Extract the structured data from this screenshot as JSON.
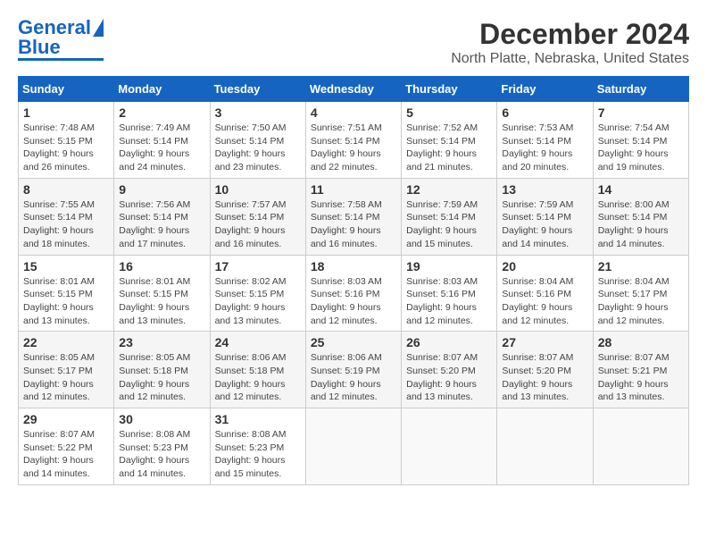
{
  "logo": {
    "line1": "General",
    "line2": "Blue"
  },
  "title": "December 2024",
  "subtitle": "North Platte, Nebraska, United States",
  "days_of_week": [
    "Sunday",
    "Monday",
    "Tuesday",
    "Wednesday",
    "Thursday",
    "Friday",
    "Saturday"
  ],
  "weeks": [
    [
      {
        "num": "1",
        "sunrise": "Sunrise: 7:48 AM",
        "sunset": "Sunset: 5:15 PM",
        "daylight": "Daylight: 9 hours and 26 minutes."
      },
      {
        "num": "2",
        "sunrise": "Sunrise: 7:49 AM",
        "sunset": "Sunset: 5:14 PM",
        "daylight": "Daylight: 9 hours and 24 minutes."
      },
      {
        "num": "3",
        "sunrise": "Sunrise: 7:50 AM",
        "sunset": "Sunset: 5:14 PM",
        "daylight": "Daylight: 9 hours and 23 minutes."
      },
      {
        "num": "4",
        "sunrise": "Sunrise: 7:51 AM",
        "sunset": "Sunset: 5:14 PM",
        "daylight": "Daylight: 9 hours and 22 minutes."
      },
      {
        "num": "5",
        "sunrise": "Sunrise: 7:52 AM",
        "sunset": "Sunset: 5:14 PM",
        "daylight": "Daylight: 9 hours and 21 minutes."
      },
      {
        "num": "6",
        "sunrise": "Sunrise: 7:53 AM",
        "sunset": "Sunset: 5:14 PM",
        "daylight": "Daylight: 9 hours and 20 minutes."
      },
      {
        "num": "7",
        "sunrise": "Sunrise: 7:54 AM",
        "sunset": "Sunset: 5:14 PM",
        "daylight": "Daylight: 9 hours and 19 minutes."
      }
    ],
    [
      {
        "num": "8",
        "sunrise": "Sunrise: 7:55 AM",
        "sunset": "Sunset: 5:14 PM",
        "daylight": "Daylight: 9 hours and 18 minutes."
      },
      {
        "num": "9",
        "sunrise": "Sunrise: 7:56 AM",
        "sunset": "Sunset: 5:14 PM",
        "daylight": "Daylight: 9 hours and 17 minutes."
      },
      {
        "num": "10",
        "sunrise": "Sunrise: 7:57 AM",
        "sunset": "Sunset: 5:14 PM",
        "daylight": "Daylight: 9 hours and 16 minutes."
      },
      {
        "num": "11",
        "sunrise": "Sunrise: 7:58 AM",
        "sunset": "Sunset: 5:14 PM",
        "daylight": "Daylight: 9 hours and 16 minutes."
      },
      {
        "num": "12",
        "sunrise": "Sunrise: 7:59 AM",
        "sunset": "Sunset: 5:14 PM",
        "daylight": "Daylight: 9 hours and 15 minutes."
      },
      {
        "num": "13",
        "sunrise": "Sunrise: 7:59 AM",
        "sunset": "Sunset: 5:14 PM",
        "daylight": "Daylight: 9 hours and 14 minutes."
      },
      {
        "num": "14",
        "sunrise": "Sunrise: 8:00 AM",
        "sunset": "Sunset: 5:14 PM",
        "daylight": "Daylight: 9 hours and 14 minutes."
      }
    ],
    [
      {
        "num": "15",
        "sunrise": "Sunrise: 8:01 AM",
        "sunset": "Sunset: 5:15 PM",
        "daylight": "Daylight: 9 hours and 13 minutes."
      },
      {
        "num": "16",
        "sunrise": "Sunrise: 8:01 AM",
        "sunset": "Sunset: 5:15 PM",
        "daylight": "Daylight: 9 hours and 13 minutes."
      },
      {
        "num": "17",
        "sunrise": "Sunrise: 8:02 AM",
        "sunset": "Sunset: 5:15 PM",
        "daylight": "Daylight: 9 hours and 13 minutes."
      },
      {
        "num": "18",
        "sunrise": "Sunrise: 8:03 AM",
        "sunset": "Sunset: 5:16 PM",
        "daylight": "Daylight: 9 hours and 12 minutes."
      },
      {
        "num": "19",
        "sunrise": "Sunrise: 8:03 AM",
        "sunset": "Sunset: 5:16 PM",
        "daylight": "Daylight: 9 hours and 12 minutes."
      },
      {
        "num": "20",
        "sunrise": "Sunrise: 8:04 AM",
        "sunset": "Sunset: 5:16 PM",
        "daylight": "Daylight: 9 hours and 12 minutes."
      },
      {
        "num": "21",
        "sunrise": "Sunrise: 8:04 AM",
        "sunset": "Sunset: 5:17 PM",
        "daylight": "Daylight: 9 hours and 12 minutes."
      }
    ],
    [
      {
        "num": "22",
        "sunrise": "Sunrise: 8:05 AM",
        "sunset": "Sunset: 5:17 PM",
        "daylight": "Daylight: 9 hours and 12 minutes."
      },
      {
        "num": "23",
        "sunrise": "Sunrise: 8:05 AM",
        "sunset": "Sunset: 5:18 PM",
        "daylight": "Daylight: 9 hours and 12 minutes."
      },
      {
        "num": "24",
        "sunrise": "Sunrise: 8:06 AM",
        "sunset": "Sunset: 5:18 PM",
        "daylight": "Daylight: 9 hours and 12 minutes."
      },
      {
        "num": "25",
        "sunrise": "Sunrise: 8:06 AM",
        "sunset": "Sunset: 5:19 PM",
        "daylight": "Daylight: 9 hours and 12 minutes."
      },
      {
        "num": "26",
        "sunrise": "Sunrise: 8:07 AM",
        "sunset": "Sunset: 5:20 PM",
        "daylight": "Daylight: 9 hours and 13 minutes."
      },
      {
        "num": "27",
        "sunrise": "Sunrise: 8:07 AM",
        "sunset": "Sunset: 5:20 PM",
        "daylight": "Daylight: 9 hours and 13 minutes."
      },
      {
        "num": "28",
        "sunrise": "Sunrise: 8:07 AM",
        "sunset": "Sunset: 5:21 PM",
        "daylight": "Daylight: 9 hours and 13 minutes."
      }
    ],
    [
      {
        "num": "29",
        "sunrise": "Sunrise: 8:07 AM",
        "sunset": "Sunset: 5:22 PM",
        "daylight": "Daylight: 9 hours and 14 minutes."
      },
      {
        "num": "30",
        "sunrise": "Sunrise: 8:08 AM",
        "sunset": "Sunset: 5:23 PM",
        "daylight": "Daylight: 9 hours and 14 minutes."
      },
      {
        "num": "31",
        "sunrise": "Sunrise: 8:08 AM",
        "sunset": "Sunset: 5:23 PM",
        "daylight": "Daylight: 9 hours and 15 minutes."
      },
      null,
      null,
      null,
      null
    ]
  ]
}
